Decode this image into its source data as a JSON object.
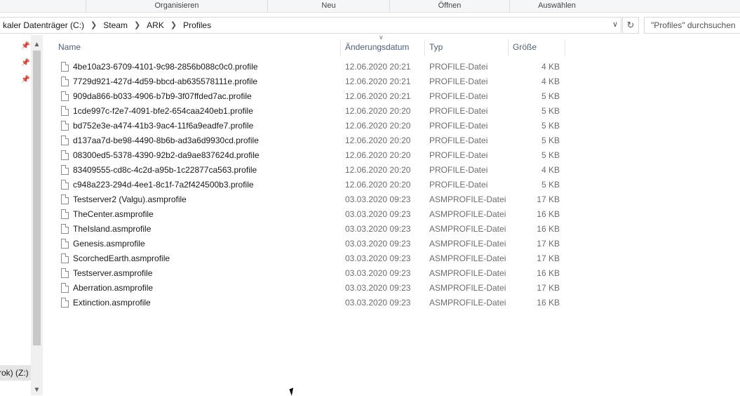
{
  "ribbon": {
    "groups": [
      "Organisieren",
      "Neu",
      "Öffnen",
      "Auswählen"
    ]
  },
  "address": {
    "crumbs": [
      "kaler Datenträger (C:)",
      "Steam",
      "ARK",
      "Profiles"
    ],
    "search_placeholder": "\"Profiles\" durchsuchen"
  },
  "nav": {
    "drive_label": "rok) (Z:)"
  },
  "columns": {
    "name": "Name",
    "date": "Änderungsdatum",
    "type": "Typ",
    "size": "Größe"
  },
  "files": [
    {
      "name": "4be10a23-6709-4101-9c98-2856b088c0c0.profile",
      "date": "12.06.2020 20:21",
      "type": "PROFILE-Datei",
      "size": "4 KB"
    },
    {
      "name": "7729d921-427d-4d59-bbcd-ab635578111e.profile",
      "date": "12.06.2020 20:21",
      "type": "PROFILE-Datei",
      "size": "4 KB"
    },
    {
      "name": "909da866-b033-4906-b7b9-3f07ffded7ac.profile",
      "date": "12.06.2020 20:21",
      "type": "PROFILE-Datei",
      "size": "5 KB"
    },
    {
      "name": "1cde997c-f2e7-4091-bfe2-654caa240eb1.profile",
      "date": "12.06.2020 20:20",
      "type": "PROFILE-Datei",
      "size": "5 KB"
    },
    {
      "name": "bd752e3e-a474-41b3-9ac4-11f6a9eadfe7.profile",
      "date": "12.06.2020 20:20",
      "type": "PROFILE-Datei",
      "size": "5 KB"
    },
    {
      "name": "d137aa7d-be98-4490-8b6b-ad3a6d9930cd.profile",
      "date": "12.06.2020 20:20",
      "type": "PROFILE-Datei",
      "size": "5 KB"
    },
    {
      "name": "08300ed5-5378-4390-92b2-da9ae837624d.profile",
      "date": "12.06.2020 20:20",
      "type": "PROFILE-Datei",
      "size": "5 KB"
    },
    {
      "name": "83409555-cd8c-4c2d-a95b-1c22877ca563.profile",
      "date": "12.06.2020 20:20",
      "type": "PROFILE-Datei",
      "size": "4 KB"
    },
    {
      "name": "c948a223-294d-4ee1-8c1f-7a2f424500b3.profile",
      "date": "12.06.2020 20:20",
      "type": "PROFILE-Datei",
      "size": "5 KB"
    },
    {
      "name": "Testserver2 (Valgu).asmprofile",
      "date": "03.03.2020 09:23",
      "type": "ASMPROFILE-Datei",
      "size": "17 KB"
    },
    {
      "name": "TheCenter.asmprofile",
      "date": "03.03.2020 09:23",
      "type": "ASMPROFILE-Datei",
      "size": "16 KB"
    },
    {
      "name": "TheIsland.asmprofile",
      "date": "03.03.2020 09:23",
      "type": "ASMPROFILE-Datei",
      "size": "16 KB"
    },
    {
      "name": "Genesis.asmprofile",
      "date": "03.03.2020 09:23",
      "type": "ASMPROFILE-Datei",
      "size": "17 KB"
    },
    {
      "name": "ScorchedEarth.asmprofile",
      "date": "03.03.2020 09:23",
      "type": "ASMPROFILE-Datei",
      "size": "17 KB"
    },
    {
      "name": "Testserver.asmprofile",
      "date": "03.03.2020 09:23",
      "type": "ASMPROFILE-Datei",
      "size": "16 KB"
    },
    {
      "name": "Aberration.asmprofile",
      "date": "03.03.2020 09:23",
      "type": "ASMPROFILE-Datei",
      "size": "17 KB"
    },
    {
      "name": "Extinction.asmprofile",
      "date": "03.03.2020 09:23",
      "type": "ASMPROFILE-Datei",
      "size": "16 KB"
    }
  ]
}
